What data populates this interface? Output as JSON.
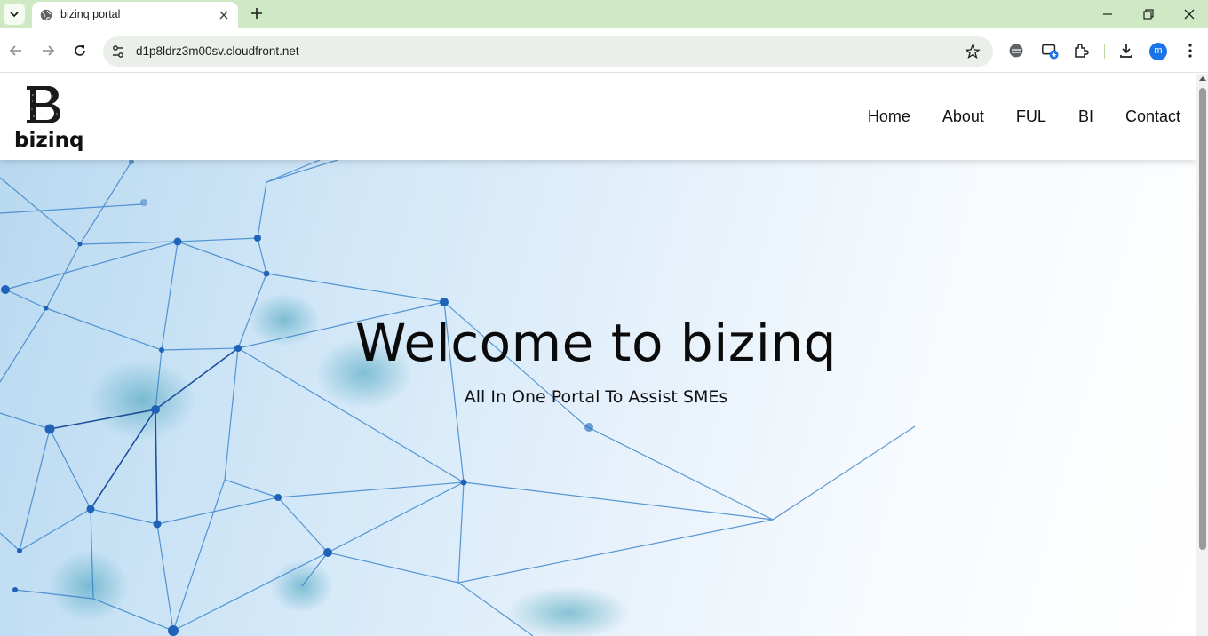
{
  "browser": {
    "tab": {
      "title": "bizinq portal"
    },
    "address": {
      "url": "d1p8ldrz3m00sv.cloudfront.net"
    },
    "profile_initial": "m",
    "accent_color": "#cfe9c4"
  },
  "site": {
    "logo": {
      "letter": "B",
      "wordmark": "bizinq."
    },
    "nav": {
      "home": "Home",
      "about": "About",
      "ful": "FUL",
      "bi": "BI",
      "contact": "Contact"
    },
    "hero": {
      "title": "Welcome to bizinq",
      "subtitle": "All In One Portal To Assist SMEs"
    }
  }
}
